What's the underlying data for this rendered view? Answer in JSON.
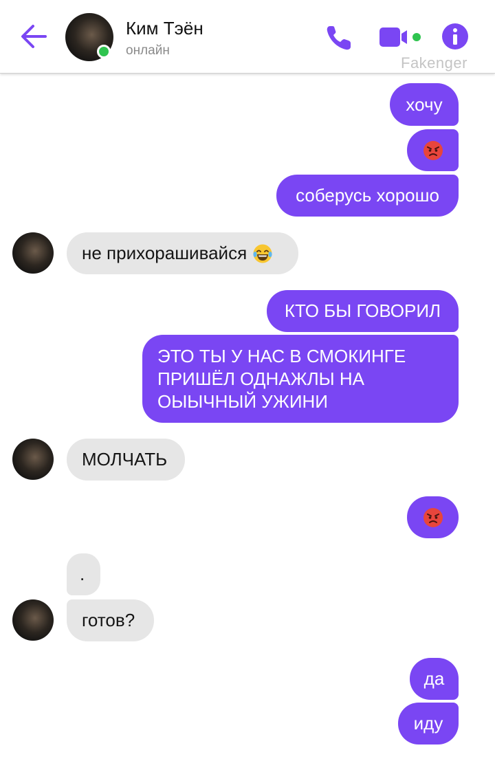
{
  "header": {
    "contact_name": "Ким Тэён",
    "status": "онлайн",
    "watermark": "Fakenger"
  },
  "colors": {
    "accent": "#7a46f3",
    "incoming": "#e6e6e6",
    "online": "#2fc44f"
  },
  "messages": [
    {
      "dir": "out",
      "text": "хочу"
    },
    {
      "dir": "out",
      "emoji": "angry-face"
    },
    {
      "dir": "out",
      "text": "соберусь хорошо"
    },
    {
      "dir": "in",
      "text": "не прихорашивайся",
      "emoji": "laughing-tears-face"
    },
    {
      "dir": "out",
      "text": "КТО БЫ ГОВОРИЛ"
    },
    {
      "dir": "out",
      "text": "ЭТО ТЫ У НАС В СМОКИНГЕ ПРИШЁЛ ОДНАЖЛЫ НА ОЫЫЧНЫЙ УЖИНИ"
    },
    {
      "dir": "in",
      "text": "МОЛЧАТЬ"
    },
    {
      "dir": "out",
      "emoji": "angry-face"
    },
    {
      "dir": "in",
      "text": "."
    },
    {
      "dir": "in",
      "text": "готов?"
    },
    {
      "dir": "out",
      "text": "да"
    },
    {
      "dir": "out",
      "text": "иду"
    }
  ]
}
